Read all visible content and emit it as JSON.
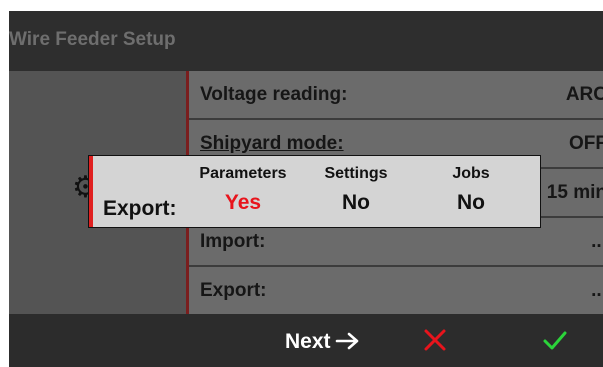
{
  "header": {
    "title": "Wire Feeder Setup"
  },
  "settings": [
    {
      "label": "Voltage reading:",
      "value": "ARC"
    },
    {
      "label": "Shipyard mode:",
      "value": "OFF"
    },
    {
      "label": "",
      "value": "15 min"
    },
    {
      "label": "Import:",
      "value": "..."
    },
    {
      "label": "Export:",
      "value": "..."
    }
  ],
  "dialog": {
    "label": "Export:",
    "options": [
      {
        "header": "Parameters",
        "value": "Yes",
        "active": true
      },
      {
        "header": "Settings",
        "value": "No",
        "active": false
      },
      {
        "header": "Jobs",
        "value": "No",
        "active": false
      }
    ]
  },
  "footer": {
    "next_label": "Next",
    "next_icon": "arrow-right-icon",
    "cancel_icon": "close-icon",
    "confirm_icon": "check-icon"
  },
  "colors": {
    "accent_red": "#e8141c",
    "confirm_green": "#2bd43a",
    "panel_accent": "#7a1e1e"
  }
}
